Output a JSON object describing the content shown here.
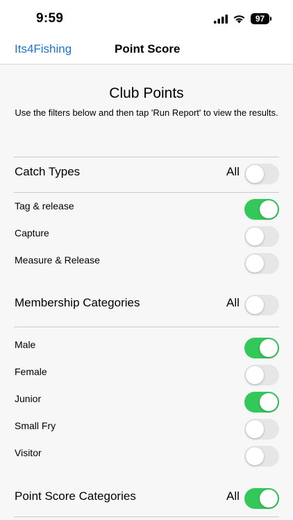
{
  "status_bar": {
    "time": "9:59",
    "battery": "97"
  },
  "nav": {
    "back_label": "Its4Fishing",
    "title": "Point Score"
  },
  "page": {
    "title": "Club Points",
    "instructions": "Use the filters below and then tap 'Run Report' to view the results."
  },
  "catch_types": {
    "label": "Catch Types",
    "all_label": "All",
    "all_on": false,
    "items": [
      {
        "label": "Tag & release",
        "on": true
      },
      {
        "label": "Capture",
        "on": false
      },
      {
        "label": "Measure & Release",
        "on": false
      }
    ]
  },
  "membership_categories": {
    "label": "Membership Categories",
    "all_label": "All",
    "all_on": false,
    "items": [
      {
        "label": "Male",
        "on": true
      },
      {
        "label": "Female",
        "on": false
      },
      {
        "label": "Junior",
        "on": true
      },
      {
        "label": "Small Fry",
        "on": false
      },
      {
        "label": "Visitor",
        "on": false
      }
    ]
  },
  "point_score_categories": {
    "label": "Point Score Categories",
    "all_label": "All",
    "all_on": true
  },
  "colors": {
    "accent": "#1a73d6",
    "toggle_on": "#34c759",
    "toggle_off": "#e6e6e6"
  }
}
